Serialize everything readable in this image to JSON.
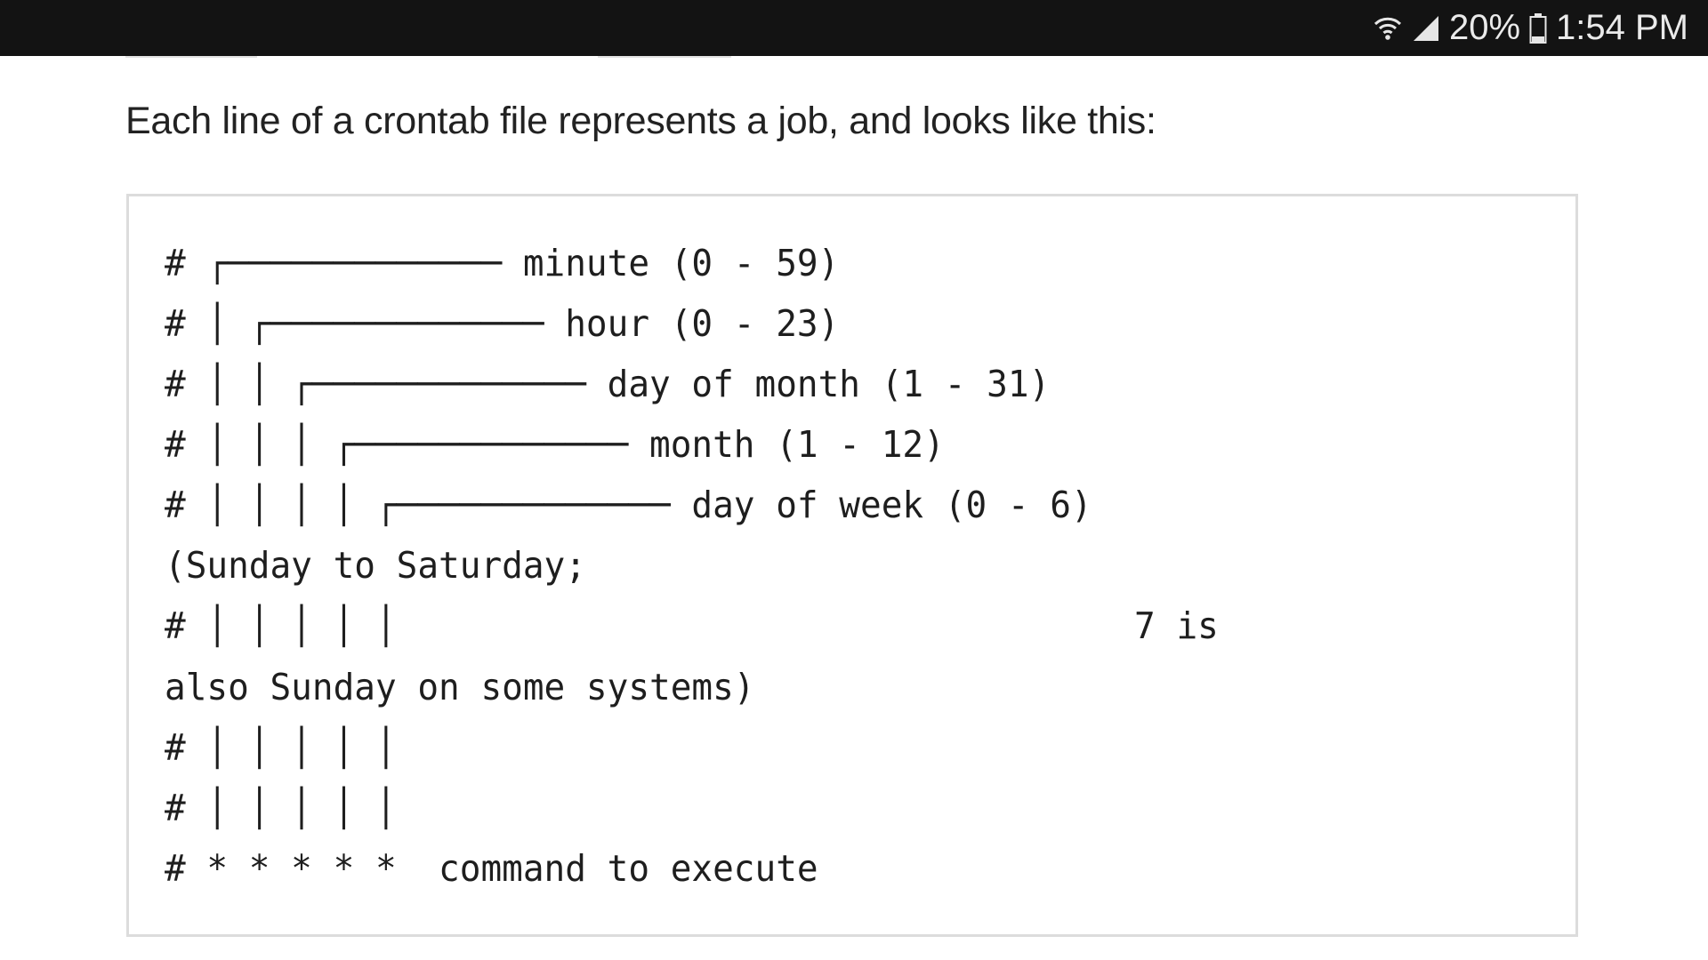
{
  "status_bar": {
    "battery_percent": "20%",
    "time": "1:54 PM",
    "icons": [
      "wifi-icon",
      "signal-icon",
      "battery-icon"
    ]
  },
  "article": {
    "intro": "Each line of a crontab file represents a job, and looks like this:",
    "code_lines": [
      "# ┌───────────── minute (0 - 59)",
      "# │ ┌───────────── hour (0 - 23)",
      "# │ │ ┌───────────── day of month (1 - 31)",
      "# │ │ │ ┌───────────── month (1 - 12)",
      "# │ │ │ │ ┌───────────── day of week (0 - 6)",
      "(Sunday to Saturday;",
      "# │ │ │ │ │                                   7 is",
      "also Sunday on some systems)",
      "# │ │ │ │ │",
      "# │ │ │ │ │",
      "# * * * * *  command to execute"
    ]
  }
}
